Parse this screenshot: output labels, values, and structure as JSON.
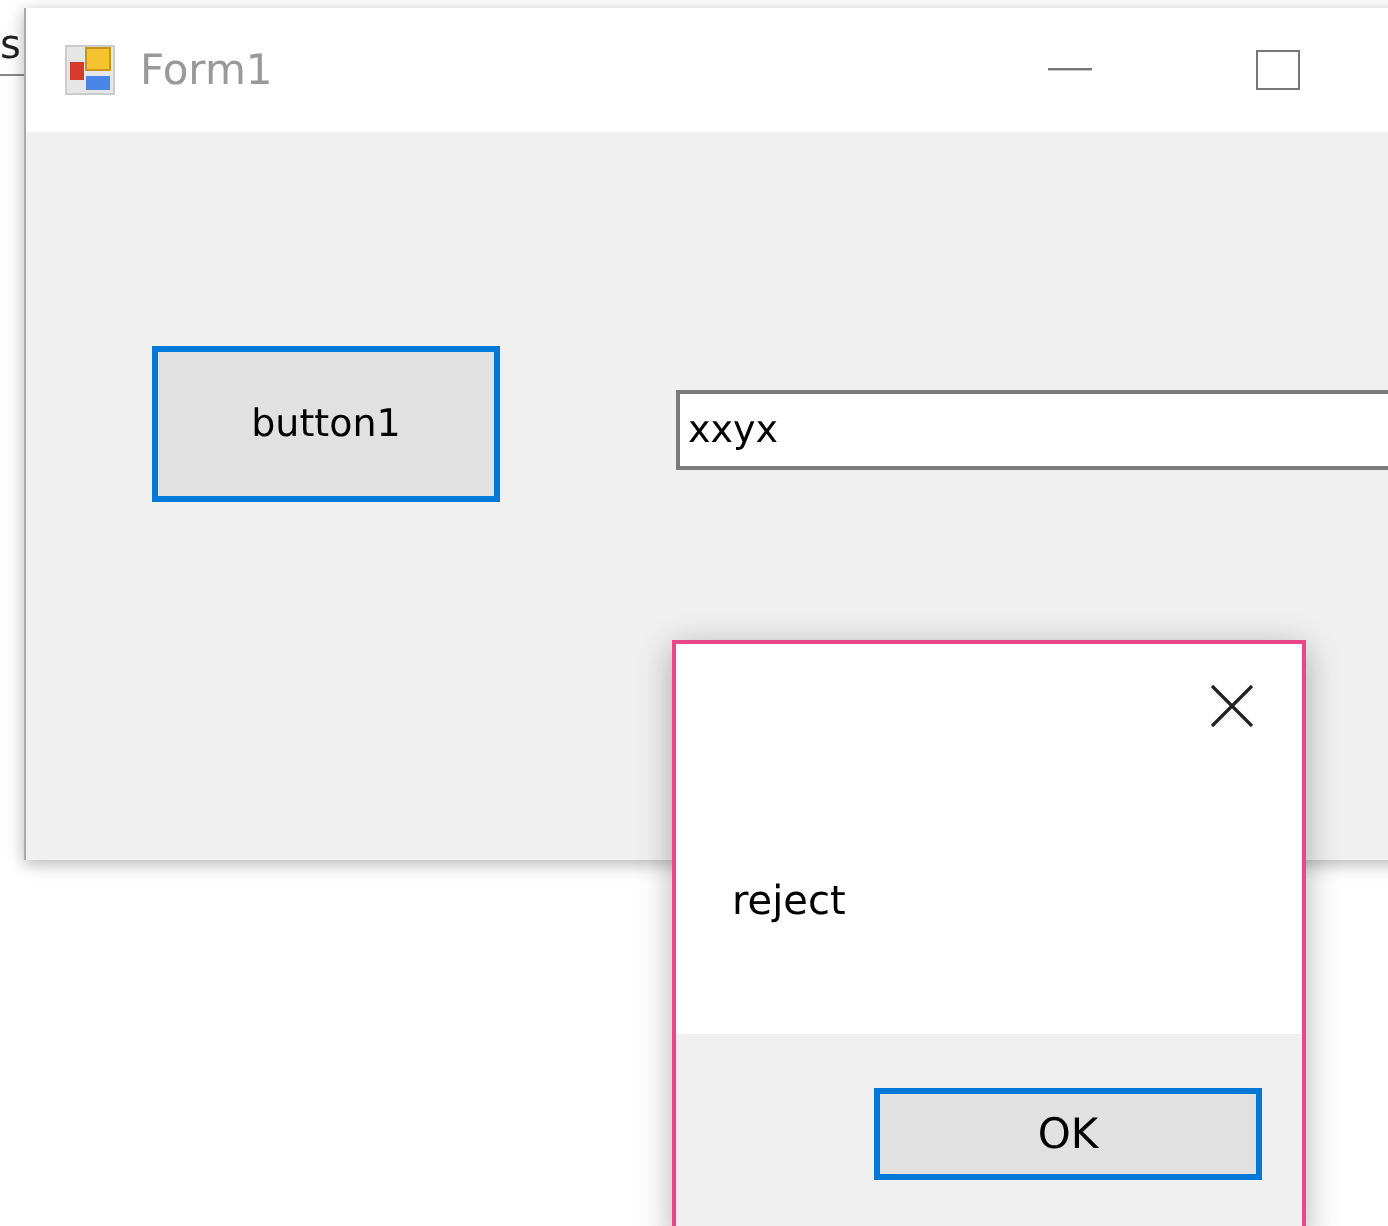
{
  "background_text": "s",
  "window": {
    "title": "Form1",
    "active": false
  },
  "form": {
    "button": {
      "label": "button1",
      "focused": true
    },
    "textbox": {
      "value": "xxyx"
    }
  },
  "dialog": {
    "message": "reject",
    "buttons": [
      {
        "label": "OK",
        "focused": true
      }
    ]
  }
}
